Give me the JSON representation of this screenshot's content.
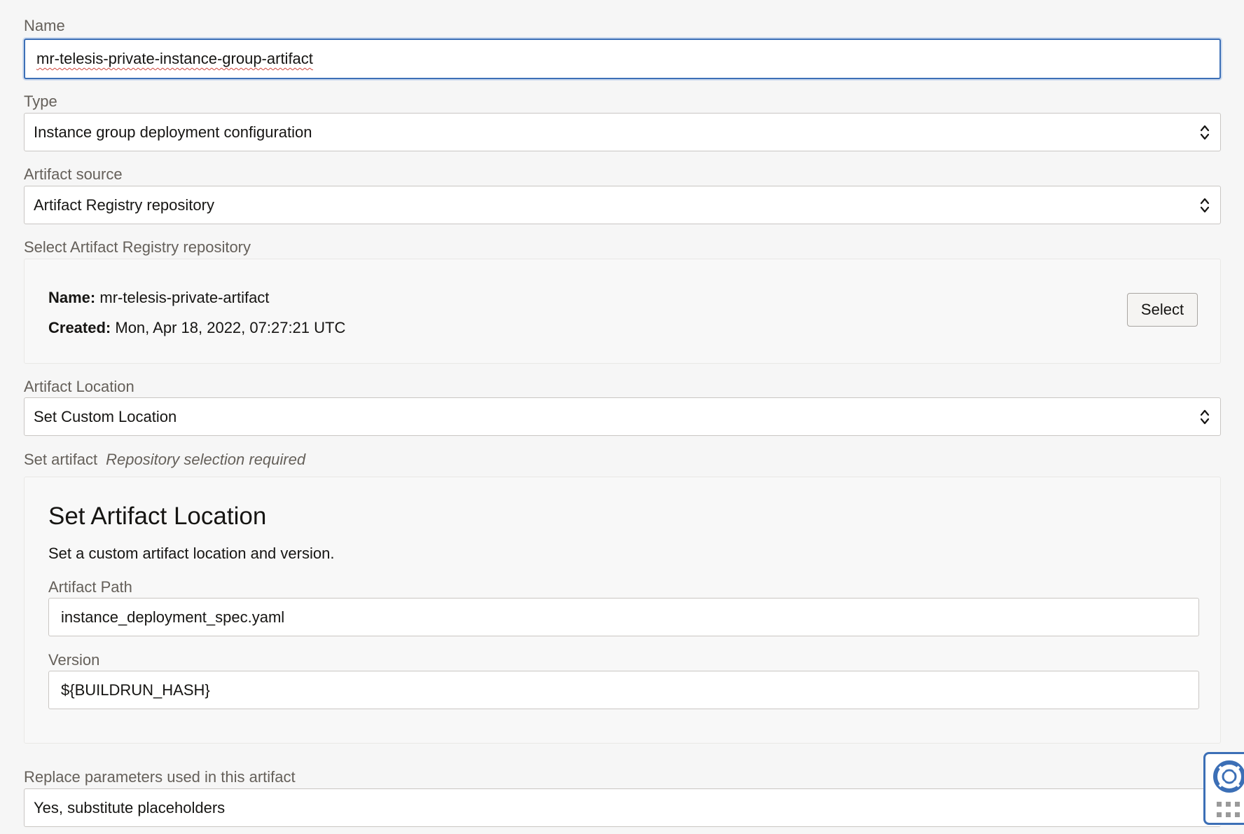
{
  "name": {
    "label": "Name",
    "value": "mr-telesis-private-instance-group-artifact"
  },
  "type": {
    "label": "Type",
    "value": "Instance group deployment configuration"
  },
  "artifact_source": {
    "label": "Artifact source",
    "value": "Artifact Registry repository"
  },
  "repository": {
    "label": "Select Artifact Registry repository",
    "name_key": "Name:",
    "name_value": "mr-telesis-private-artifact",
    "created_key": "Created:",
    "created_value": "Mon, Apr 18, 2022, 07:27:21 UTC",
    "select_button": "Select"
  },
  "artifact_location": {
    "label": "Artifact Location",
    "value": "Set Custom Location"
  },
  "set_artifact": {
    "label": "Set artifact",
    "hint": "Repository selection required",
    "title": "Set Artifact Location",
    "description": "Set a custom artifact location and version.",
    "path_label": "Artifact Path",
    "path_value": "instance_deployment_spec.yaml",
    "version_label": "Version",
    "version_value": "${BUILDRUN_HASH}"
  },
  "replace_parameters": {
    "label": "Replace parameters used in this artifact",
    "value": "Yes, substitute placeholders"
  },
  "icons": {
    "select_arrows": "chevron-up-down-icon",
    "help": "lifebuoy-icon",
    "apps": "grid-dots-icon"
  },
  "colors": {
    "focus": "#3c6fb6",
    "background": "#f6f6f6"
  }
}
